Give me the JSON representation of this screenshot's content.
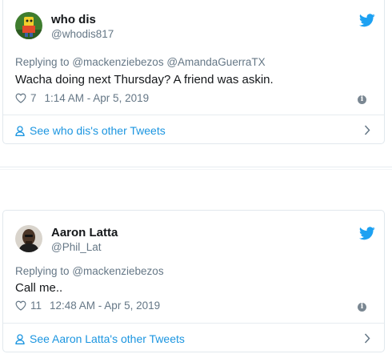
{
  "colors": {
    "twitter_blue": "#1da1f2",
    "link_blue": "#1b95e0",
    "muted": "#657786",
    "border": "#e1e8ed"
  },
  "tweets": [
    {
      "name": "who dis",
      "handle": "@whodis817",
      "replying_prefix": "Replying to",
      "mentions": "@mackenziebezos @AmandaGuerraTX",
      "text": "Wacha doing next Thursday? A friend was askin.",
      "likes": "7",
      "timestamp": "1:14 AM - Apr 5, 2019",
      "footer_link": "See who dis's other Tweets",
      "icons": {
        "avatar": "avatar",
        "bird": "twitter-bird-icon",
        "heart": "heart-icon",
        "info": "info-icon",
        "person": "person-icon",
        "chevron": "chevron-right-icon"
      }
    },
    {
      "name": "Aaron Latta",
      "handle": "@Phil_Lat",
      "replying_prefix": "Replying to",
      "mentions": "@mackenziebezos",
      "text": "Call me..",
      "likes": "11",
      "timestamp": "12:48 AM - Apr 5, 2019",
      "footer_link": "See Aaron Latta's other Tweets",
      "icons": {
        "avatar": "avatar",
        "bird": "twitter-bird-icon",
        "heart": "heart-icon",
        "info": "info-icon",
        "person": "person-icon",
        "chevron": "chevron-right-icon"
      }
    }
  ]
}
